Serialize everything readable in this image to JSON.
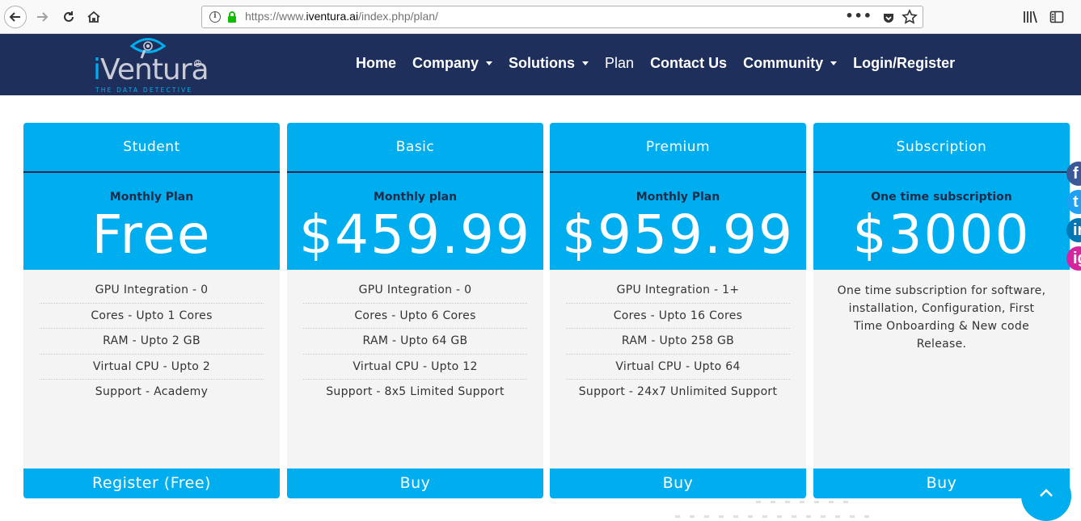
{
  "browser": {
    "url_prefix": "https://www.",
    "url_domain": "iventura.ai",
    "url_path": "/index.php/plan/"
  },
  "logo": {
    "name_i": "i",
    "name_rest": "Ventura",
    "tagline": "THE DATA DETECTIVE",
    "registered": "R"
  },
  "nav": {
    "items": [
      {
        "label": "Home",
        "has_caret": false
      },
      {
        "label": "Company",
        "has_caret": true
      },
      {
        "label": "Solutions",
        "has_caret": true
      },
      {
        "label": "Plan",
        "has_caret": false
      },
      {
        "label": "Contact Us",
        "has_caret": false
      },
      {
        "label": "Community",
        "has_caret": true
      },
      {
        "label": "Login/Register",
        "has_caret": false
      }
    ]
  },
  "plans": [
    {
      "title": "Student",
      "period": "Monthly Plan",
      "price": "Free",
      "features": [
        "GPU Integration - 0",
        "Cores - Upto 1 Cores",
        "RAM - Upto 2 GB",
        "Virtual CPU - Upto 2",
        "Support - Academy"
      ],
      "button": "Register (Free)"
    },
    {
      "title": "Basic",
      "period": "Monthly plan",
      "price": "$459.99",
      "features": [
        "GPU Integration - 0",
        "Cores - Upto 6 Cores",
        "RAM - Upto 64 GB",
        "Virtual CPU - Upto 12",
        "Support - 8x5 Limited Support"
      ],
      "button": "Buy"
    },
    {
      "title": "Premium",
      "period": "Monthly Plan",
      "price": "$959.99",
      "features": [
        "GPU Integration - 1+",
        "Cores - Upto 16 Cores",
        "RAM - Upto 258 GB",
        "Virtual CPU - Upto 64",
        "Support - 24x7 Unlimited Support"
      ],
      "button": "Buy"
    },
    {
      "title": "Subscription",
      "period": "One time subscription",
      "price": "$3000",
      "description": "One time subscription for software, installation, Configuration, First Time Onboarding & New code Release.",
      "button": "Buy"
    }
  ],
  "social": {
    "facebook": "f",
    "twitter": "t",
    "linkedin": "in",
    "instagram": "ig"
  },
  "colors": {
    "header_bg": "#1f2f5c",
    "accent": "#00aeef",
    "card_body": "#f4f4f4"
  }
}
